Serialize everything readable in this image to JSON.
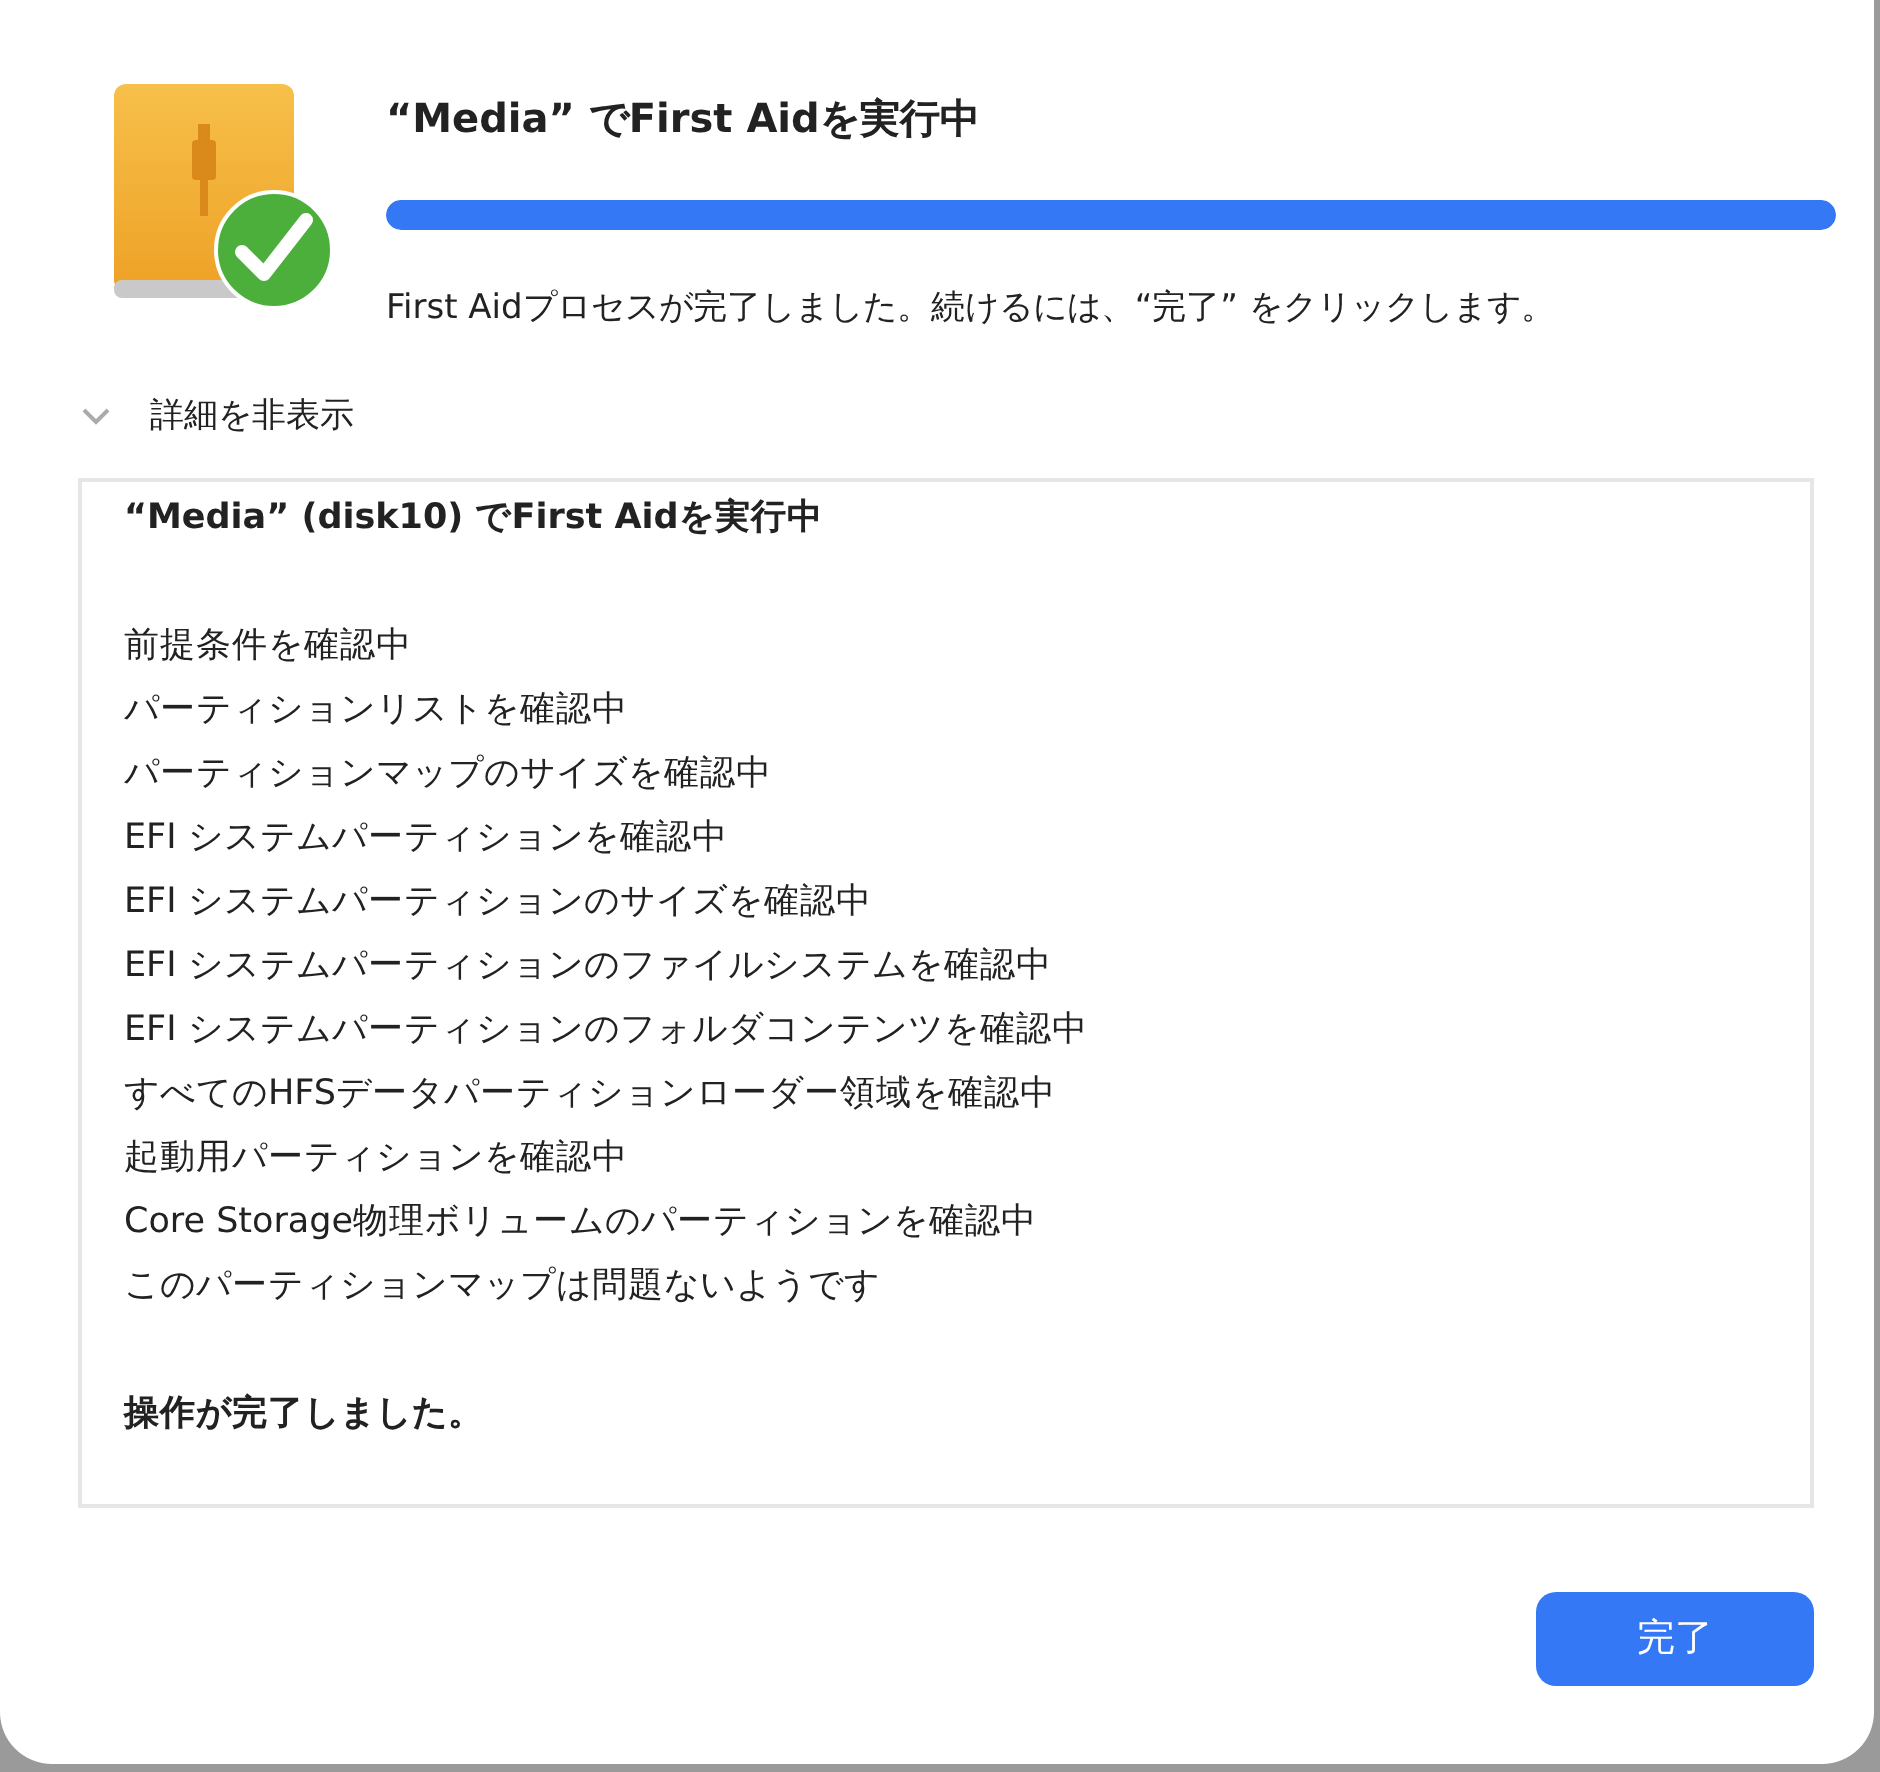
{
  "dialog": {
    "title": "“Media” でFirst Aidを実行中",
    "progress": {
      "level": 1.0
    },
    "message": "First Aidプロセスが完了しました。続けるには、“完了” をクリックします。"
  },
  "details": {
    "label": "詳細を非表示",
    "expanded": true
  },
  "log": [
    {
      "kind": "heading",
      "text": "“Media” (disk10) でFirst Aidを実行中"
    },
    {
      "kind": "step",
      "text": "前提条件を確認中"
    },
    {
      "kind": "step",
      "text": "パーティションリストを確認中"
    },
    {
      "kind": "step",
      "text": "パーティションマップのサイズを確認中"
    },
    {
      "kind": "step",
      "text": "EFI システムパーティションを確認中"
    },
    {
      "kind": "step",
      "text": "EFI システムパーティションのサイズを確認中"
    },
    {
      "kind": "step",
      "text": "EFI システムパーティションのファイルシステムを確認中"
    },
    {
      "kind": "step",
      "text": "EFI システムパーティションのフォルダコンテンツを確認中"
    },
    {
      "kind": "step",
      "text": "すべてのHFSデータパーティションローダー領域を確認中"
    },
    {
      "kind": "step",
      "text": "起動用パーティションを確認中"
    },
    {
      "kind": "step",
      "text": "Core Storage物理ボリュームのパーティションを確認中"
    },
    {
      "kind": "step",
      "text": "このパーティションマップは問題ないようです"
    },
    {
      "kind": "result",
      "text": "操作が完了しました。"
    }
  ],
  "buttons": [
    {
      "label": "完了",
      "kind": "primary"
    }
  ]
}
